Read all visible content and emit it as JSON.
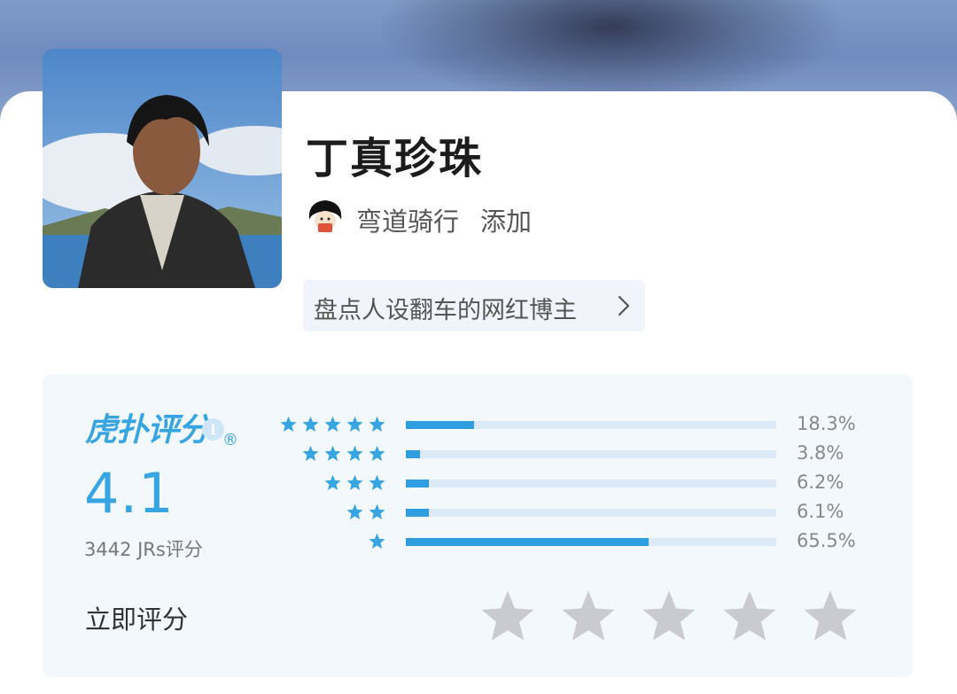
{
  "profile": {
    "name": "丁真珍珠",
    "user": {
      "name": "弯道骑行",
      "action": "添加"
    },
    "tag": "盘点人设翻车的网红博主"
  },
  "rating": {
    "brand": "虎扑评分",
    "brand_mark": "®",
    "info_icon": "i",
    "score": "4.1",
    "count_text": "3442 JRs评分",
    "rate_now": "立即评分",
    "bars": [
      {
        "stars": 5,
        "percent_label": "18.3%",
        "percent": 18.3
      },
      {
        "stars": 4,
        "percent_label": "3.8%",
        "percent": 3.8
      },
      {
        "stars": 3,
        "percent_label": "6.2%",
        "percent": 6.2
      },
      {
        "stars": 2,
        "percent_label": "6.1%",
        "percent": 6.1
      },
      {
        "stars": 1,
        "percent_label": "65.5%",
        "percent": 65.5
      }
    ]
  },
  "colors": {
    "accent": "#36a5e2",
    "bar_fill": "#2f9ee0",
    "bar_track": "#dbeaf6",
    "panel_bg": "#f3f8fd",
    "empty_star": "#c9cbd0"
  },
  "icons": [
    "chevron-right-icon",
    "info-icon",
    "star-icon"
  ]
}
